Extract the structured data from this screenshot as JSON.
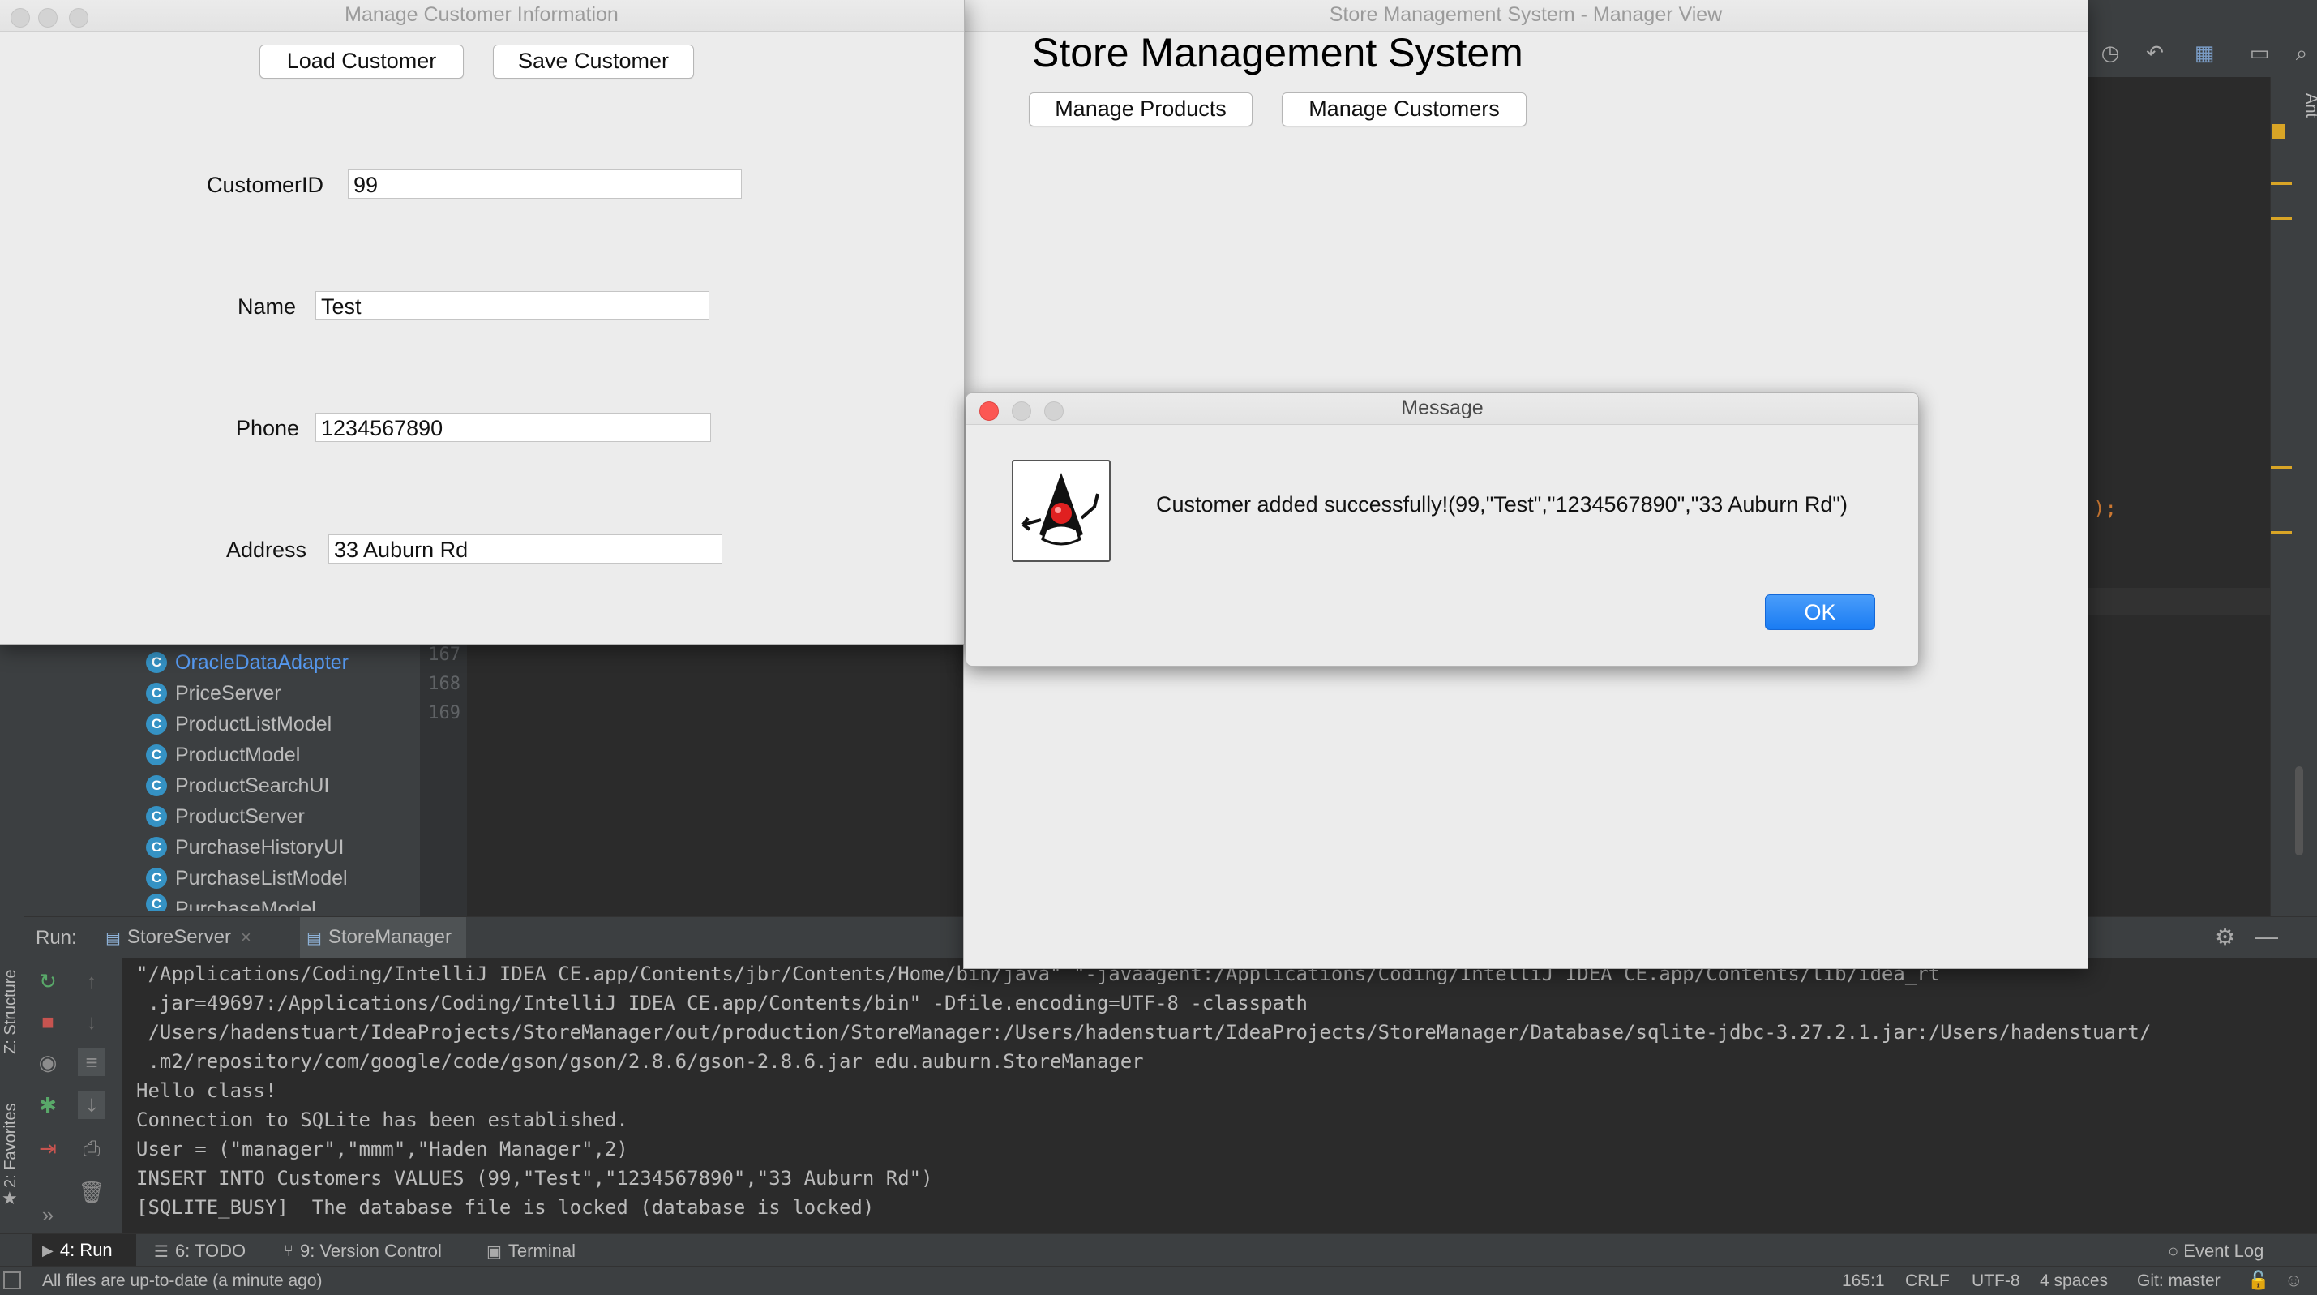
{
  "customer_window": {
    "title": "Manage Customer Information",
    "load_button": "Load Customer",
    "save_button": "Save Customer",
    "fields": {
      "customer_id": {
        "label": "CustomerID",
        "value": "99"
      },
      "name": {
        "label": "Name",
        "value": "Test"
      },
      "phone": {
        "label": "Phone",
        "value": "1234567890"
      },
      "address": {
        "label": "Address",
        "value": "33 Auburn Rd"
      }
    }
  },
  "manager_window": {
    "title": "Store Management System - Manager View",
    "heading": "Store Management System",
    "manage_products_button": "Manage Products",
    "manage_customers_button": "Manage Customers"
  },
  "message_dialog": {
    "title": "Message",
    "text": "Customer added successfully!(99,\"Test\",\"1234567890\",\"33 Auburn Rd\")",
    "ok_button": "OK",
    "ok_color": "#1a7cf3",
    "close_color": "#fc5753"
  },
  "ide": {
    "project_tree": [
      "OracleDataAdapter",
      "PriceServer",
      "ProductListModel",
      "ProductModel",
      "ProductSearchUI",
      "ProductServer",
      "PurchaseHistoryUI",
      "PurchaseListModel",
      "PurchaseModel"
    ],
    "line_numbers": [
      "167",
      "168",
      "169"
    ],
    "editor_fragment": ");",
    "run_label": "Run:",
    "run_tabs": [
      "StoreServer",
      "StoreManager"
    ],
    "console_lines": [
      "\"/Applications/Coding/IntelliJ IDEA CE.app/Contents/jbr/Contents/Home/bin/java\" \"-javaagent:/Applications/Coding/IntelliJ IDEA CE.app/Contents/lib/idea_rt",
      " .jar=49697:/Applications/Coding/IntelliJ IDEA CE.app/Contents/bin\" -Dfile.encoding=UTF-8 -classpath",
      " /Users/hadenstuart/IdeaProjects/StoreManager/out/production/StoreManager:/Users/hadenstuart/IdeaProjects/StoreManager/Database/sqlite-jdbc-3.27.2.1.jar:/Users/hadenstuart/",
      " .m2/repository/com/google/code/gson/gson/2.8.6/gson-2.8.6.jar edu.auburn.StoreManager",
      "Hello class!",
      "Connection to SQLite has been established.",
      "User = (\"manager\",\"mmm\",\"Haden Manager\",2)",
      "INSERT INTO Customers VALUES (99,\"Test\",\"1234567890\",\"33 Auburn Rd\")",
      "[SQLITE_BUSY]  The database file is locked (database is locked)"
    ],
    "bottom_tabs": {
      "run": "4: Run",
      "todo": "6: TODO",
      "vcs": "9: Version Control",
      "terminal": "Terminal",
      "event_log": "Event Log"
    },
    "side_tabs": {
      "structure": "Z: Structure",
      "favorites": "2: Favorites",
      "ant": "Ant"
    },
    "status": {
      "message": "All files are up-to-date (a minute ago)",
      "position": "165:1",
      "line_sep": "CRLF",
      "encoding": "UTF-8",
      "indent": "4 spaces",
      "git": "Git: master"
    }
  }
}
